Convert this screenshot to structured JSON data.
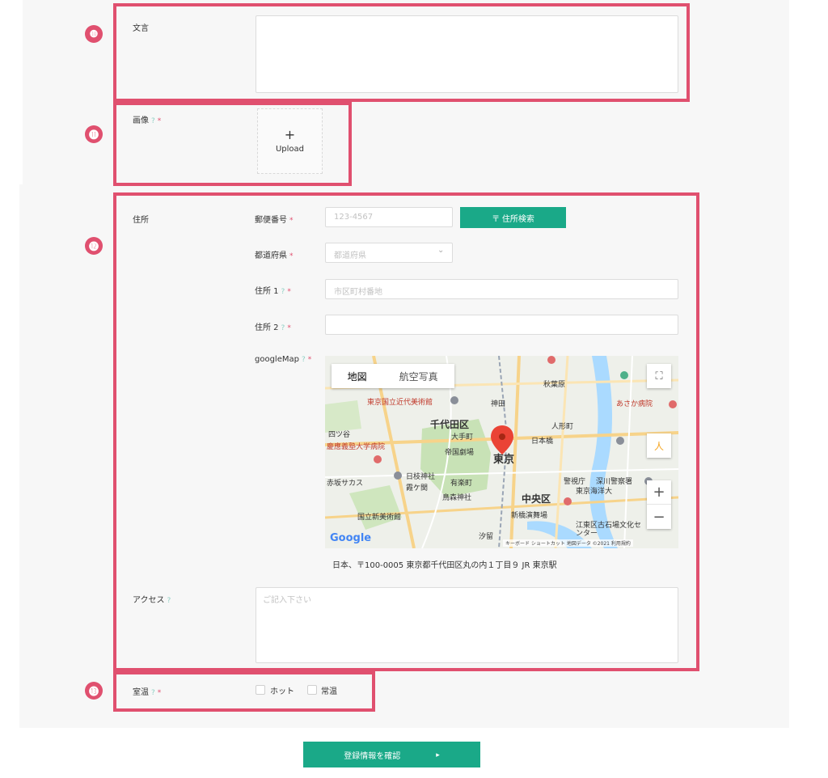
{
  "colors": {
    "highlight": "#e0506f",
    "accent": "#1aa988",
    "panel": "#f7f7f7"
  },
  "badges": [
    "❿",
    "⓫",
    "⓬",
    "⓭"
  ],
  "message": {
    "label": "文言"
  },
  "image": {
    "label": "画像",
    "help": "?",
    "required": "*",
    "upload_plus": "+",
    "upload_label": "Upload"
  },
  "address": {
    "section_label": "住所",
    "postal": {
      "label": "郵便番号",
      "required": "*",
      "placeholder": "123-4567",
      "search_button": "〒 住所検索"
    },
    "prefecture": {
      "label": "都道府県",
      "required": "*",
      "placeholder": "都道府県",
      "chevron": "⌄"
    },
    "address1": {
      "label": "住所 1",
      "help": "?",
      "required": "*",
      "placeholder": "市区町村番地"
    },
    "address2": {
      "label": "住所 2",
      "help": "?",
      "required": "*",
      "placeholder": ""
    },
    "googlemap": {
      "label": "googleMap",
      "help": "?",
      "required": "*",
      "tab_map": "地図",
      "tab_satellite": "航空写真",
      "area_labels": [
        "千代田区",
        "東京",
        "中央区",
        "大手町",
        "帝国劇場",
        "日本橋",
        "有楽町",
        "鳥森神社",
        "東京国立近代美術館",
        "慶應義塾大学病院",
        "四ツ谷",
        "赤坂サカス",
        "国立新美術館",
        "日枝神社",
        "霞ケ関",
        "新橋演舞場",
        "警視庁",
        "深川警察署",
        "東京海洋大",
        "江東区古石場文化センター",
        "秋葉原",
        "人形町",
        "あさか病院",
        "汐留",
        "神田"
      ],
      "google_logo": "Google",
      "attribution": "キーボード ショートカット  地図データ ©2021  利用規約",
      "zoom_in": "+",
      "zoom_out": "−",
      "fullscreen": "⛶",
      "pegman": "人",
      "address_text": "日本、〒100-0005 東京都千代田区丸の内１丁目９ JR 東京駅"
    },
    "access": {
      "label": "アクセス",
      "help": "?",
      "placeholder": "ご記入下さい"
    }
  },
  "temperature": {
    "label": "室温",
    "help": "?",
    "required": "*",
    "options": [
      "ホット",
      "常温"
    ]
  },
  "submit": {
    "label": "登録情報を確認",
    "arrow": "▸"
  }
}
